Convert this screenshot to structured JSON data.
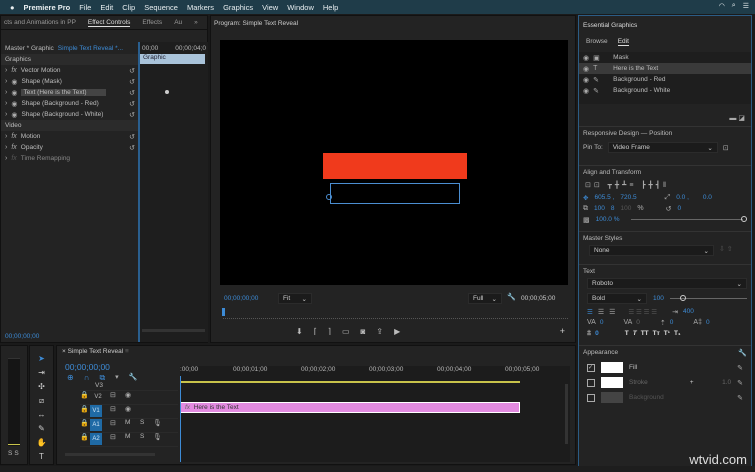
{
  "menubar": {
    "apple": "",
    "app": "Premiere Pro",
    "items": [
      "File",
      "Edit",
      "Clip",
      "Sequence",
      "Markers",
      "Graphics",
      "View",
      "Window",
      "Help"
    ]
  },
  "effect_panel": {
    "tabs": [
      "cts and Animations in PP",
      "Effect Controls",
      "Effects",
      "Au"
    ],
    "overflow": "»",
    "master_label": "Master * Graphic",
    "clip_label": "Simple Text Reveal *...",
    "time_start": "00;00",
    "time_end": "00;00;04;0",
    "graphic_clip": "Graphic",
    "section_graphics": "Graphics",
    "graphics_items": [
      {
        "icon": "fx",
        "label": "Vector Motion"
      },
      {
        "icon": "eye",
        "label": "Shape (Mask)"
      },
      {
        "icon": "eye",
        "label": "Text (Here is the Text)"
      },
      {
        "icon": "eye",
        "label": "Shape (Background - Red)"
      },
      {
        "icon": "eye",
        "label": "Shape (Background - White)"
      }
    ],
    "section_video": "Video",
    "video_items": [
      {
        "icon": "fx",
        "label": "Motion"
      },
      {
        "icon": "fx",
        "label": "Opacity"
      },
      {
        "icon": "fx",
        "label": "Time Remapping"
      }
    ],
    "timecode": "00;00;00;00"
  },
  "program": {
    "title": "Program: Simple Text Reveal",
    "timecode": "00;00;00;00",
    "zoom": "Fit",
    "resolution": "Full",
    "duration": "00;00;05;00",
    "red_color": "#f03a1c"
  },
  "essential_graphics": {
    "title": "Essential Graphics",
    "tabs": [
      "Browse",
      "Edit"
    ],
    "layers": [
      "Mask",
      "Here is the Text",
      "Background - Red",
      "Background - White"
    ],
    "responsive_title": "Responsive Design — Position",
    "pin_to_label": "Pin To:",
    "pin_to_value": "Video Frame",
    "align_title": "Align and Transform",
    "pos_x": "605.5 ,",
    "pos_y": "720.5",
    "anchor_x": "0.0 ,",
    "anchor_y": "0.0",
    "scale": "100",
    "scale_h": "100",
    "percent": "%",
    "rotation": "0",
    "opacity": "100.0 %",
    "master_styles_title": "Master Styles",
    "master_style_value": "None",
    "text_title": "Text",
    "font": "Roboto",
    "font_style": "Bold",
    "font_size": "100",
    "leading": "400",
    "kerning": "0",
    "tracking": "0",
    "baseline": "0",
    "tsume": "0",
    "indent": "0",
    "style_buttons": [
      "T",
      "T",
      "TT",
      "Tт",
      "T¹",
      "T₁"
    ],
    "appearance_title": "Appearance",
    "appearance": [
      {
        "label": "Fill",
        "checked": true
      },
      {
        "label": "Stroke",
        "checked": false,
        "value": "1.0"
      },
      {
        "label": "Background",
        "checked": false
      }
    ]
  },
  "timeline": {
    "title": "Simple Text Reveal",
    "timecode": "00;00;00;00",
    "ruler": [
      ":00;00",
      "00;00;01;00",
      "00;00;02;00",
      "00;00;03;00",
      "00;00;04;00",
      "00;00;05;00"
    ],
    "tracks": [
      "V3",
      "V2",
      "V1",
      "A1",
      "A2"
    ],
    "clip_label": "Here is the Text",
    "clip_color": "#e28ae0",
    "meter_labels": [
      "S",
      "S"
    ],
    "mute": "M",
    "solo": "S"
  },
  "watermark": "wtvid.com"
}
